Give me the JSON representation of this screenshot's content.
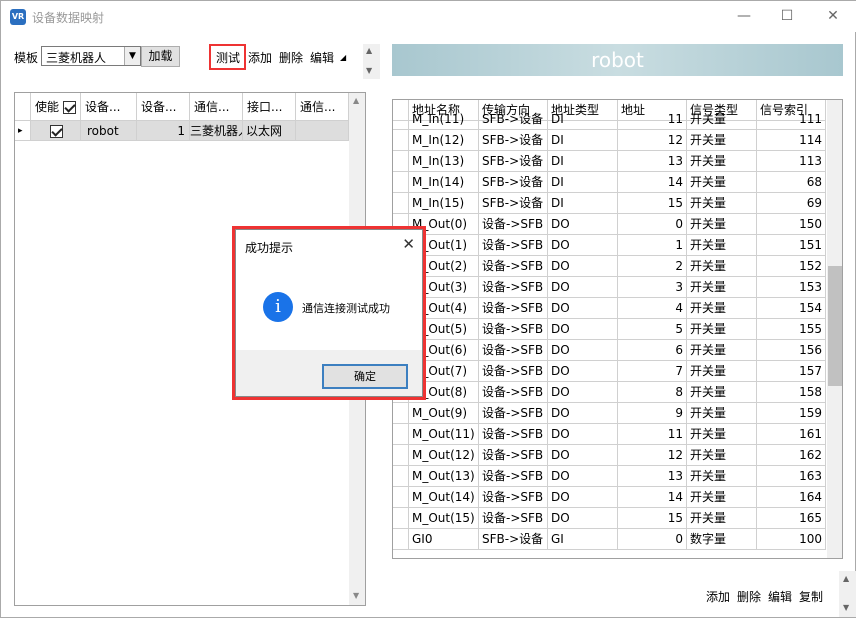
{
  "window": {
    "title": "设备数据映射",
    "icon_text": "VR",
    "min": "—",
    "max": "☐",
    "close": "✕"
  },
  "toolbar": {
    "template_label": "模板",
    "template_value": "三菱机器人",
    "load": "加载",
    "test": "测试",
    "add": "添加",
    "delete": "删除",
    "edit": "编辑"
  },
  "banner": {
    "title": "robot"
  },
  "left_grid": {
    "headers": [
      "使能",
      "设备...",
      "设备...",
      "通信...",
      "接口...",
      "通信..."
    ],
    "rows": [
      {
        "marker": "▸",
        "name": "robot",
        "num": "1",
        "comm": "三菱机器人",
        "iface": "以太网",
        "comm2": ""
      }
    ]
  },
  "right_grid": {
    "headers": [
      "地址名称",
      "传输方向",
      "地址类型",
      "地址",
      "信号类型",
      "信号索引"
    ],
    "rows": [
      [
        "M_In(11)",
        "SFB->设备",
        "DI",
        "11",
        "开关量",
        "111"
      ],
      [
        "M_In(12)",
        "SFB->设备",
        "DI",
        "12",
        "开关量",
        "114"
      ],
      [
        "M_In(13)",
        "SFB->设备",
        "DI",
        "13",
        "开关量",
        "113"
      ],
      [
        "M_In(14)",
        "SFB->设备",
        "DI",
        "14",
        "开关量",
        "68"
      ],
      [
        "M_In(15)",
        "SFB->设备",
        "DI",
        "15",
        "开关量",
        "69"
      ],
      [
        "M_Out(0)",
        "设备->SFB",
        "DO",
        "0",
        "开关量",
        "150"
      ],
      [
        "M_Out(1)",
        "设备->SFB",
        "DO",
        "1",
        "开关量",
        "151"
      ],
      [
        "M_Out(2)",
        "设备->SFB",
        "DO",
        "2",
        "开关量",
        "152"
      ],
      [
        "M_Out(3)",
        "设备->SFB",
        "DO",
        "3",
        "开关量",
        "153"
      ],
      [
        "M_Out(4)",
        "设备->SFB",
        "DO",
        "4",
        "开关量",
        "154"
      ],
      [
        "M_Out(5)",
        "设备->SFB",
        "DO",
        "5",
        "开关量",
        "155"
      ],
      [
        "M_Out(6)",
        "设备->SFB",
        "DO",
        "6",
        "开关量",
        "156"
      ],
      [
        "M_Out(7)",
        "设备->SFB",
        "DO",
        "7",
        "开关量",
        "157"
      ],
      [
        "M_Out(8)",
        "设备->SFB",
        "DO",
        "8",
        "开关量",
        "158"
      ],
      [
        "M_Out(9)",
        "设备->SFB",
        "DO",
        "9",
        "开关量",
        "159"
      ],
      [
        "M_Out(11)",
        "设备->SFB",
        "DO",
        "11",
        "开关量",
        "161"
      ],
      [
        "M_Out(12)",
        "设备->SFB",
        "DO",
        "12",
        "开关量",
        "162"
      ],
      [
        "M_Out(13)",
        "设备->SFB",
        "DO",
        "13",
        "开关量",
        "163"
      ],
      [
        "M_Out(14)",
        "设备->SFB",
        "DO",
        "14",
        "开关量",
        "164"
      ],
      [
        "M_Out(15)",
        "设备->SFB",
        "DO",
        "15",
        "开关量",
        "165"
      ],
      [
        "GI0",
        "SFB->设备",
        "GI",
        "0",
        "数字量",
        "100"
      ]
    ]
  },
  "bottom_actions": {
    "add": "添加",
    "delete": "删除",
    "edit": "编辑",
    "copy": "复制"
  },
  "dialog": {
    "title": "成功提示",
    "close": "✕",
    "icon": "i",
    "message": "通信连接测试成功",
    "ok": "确定"
  }
}
